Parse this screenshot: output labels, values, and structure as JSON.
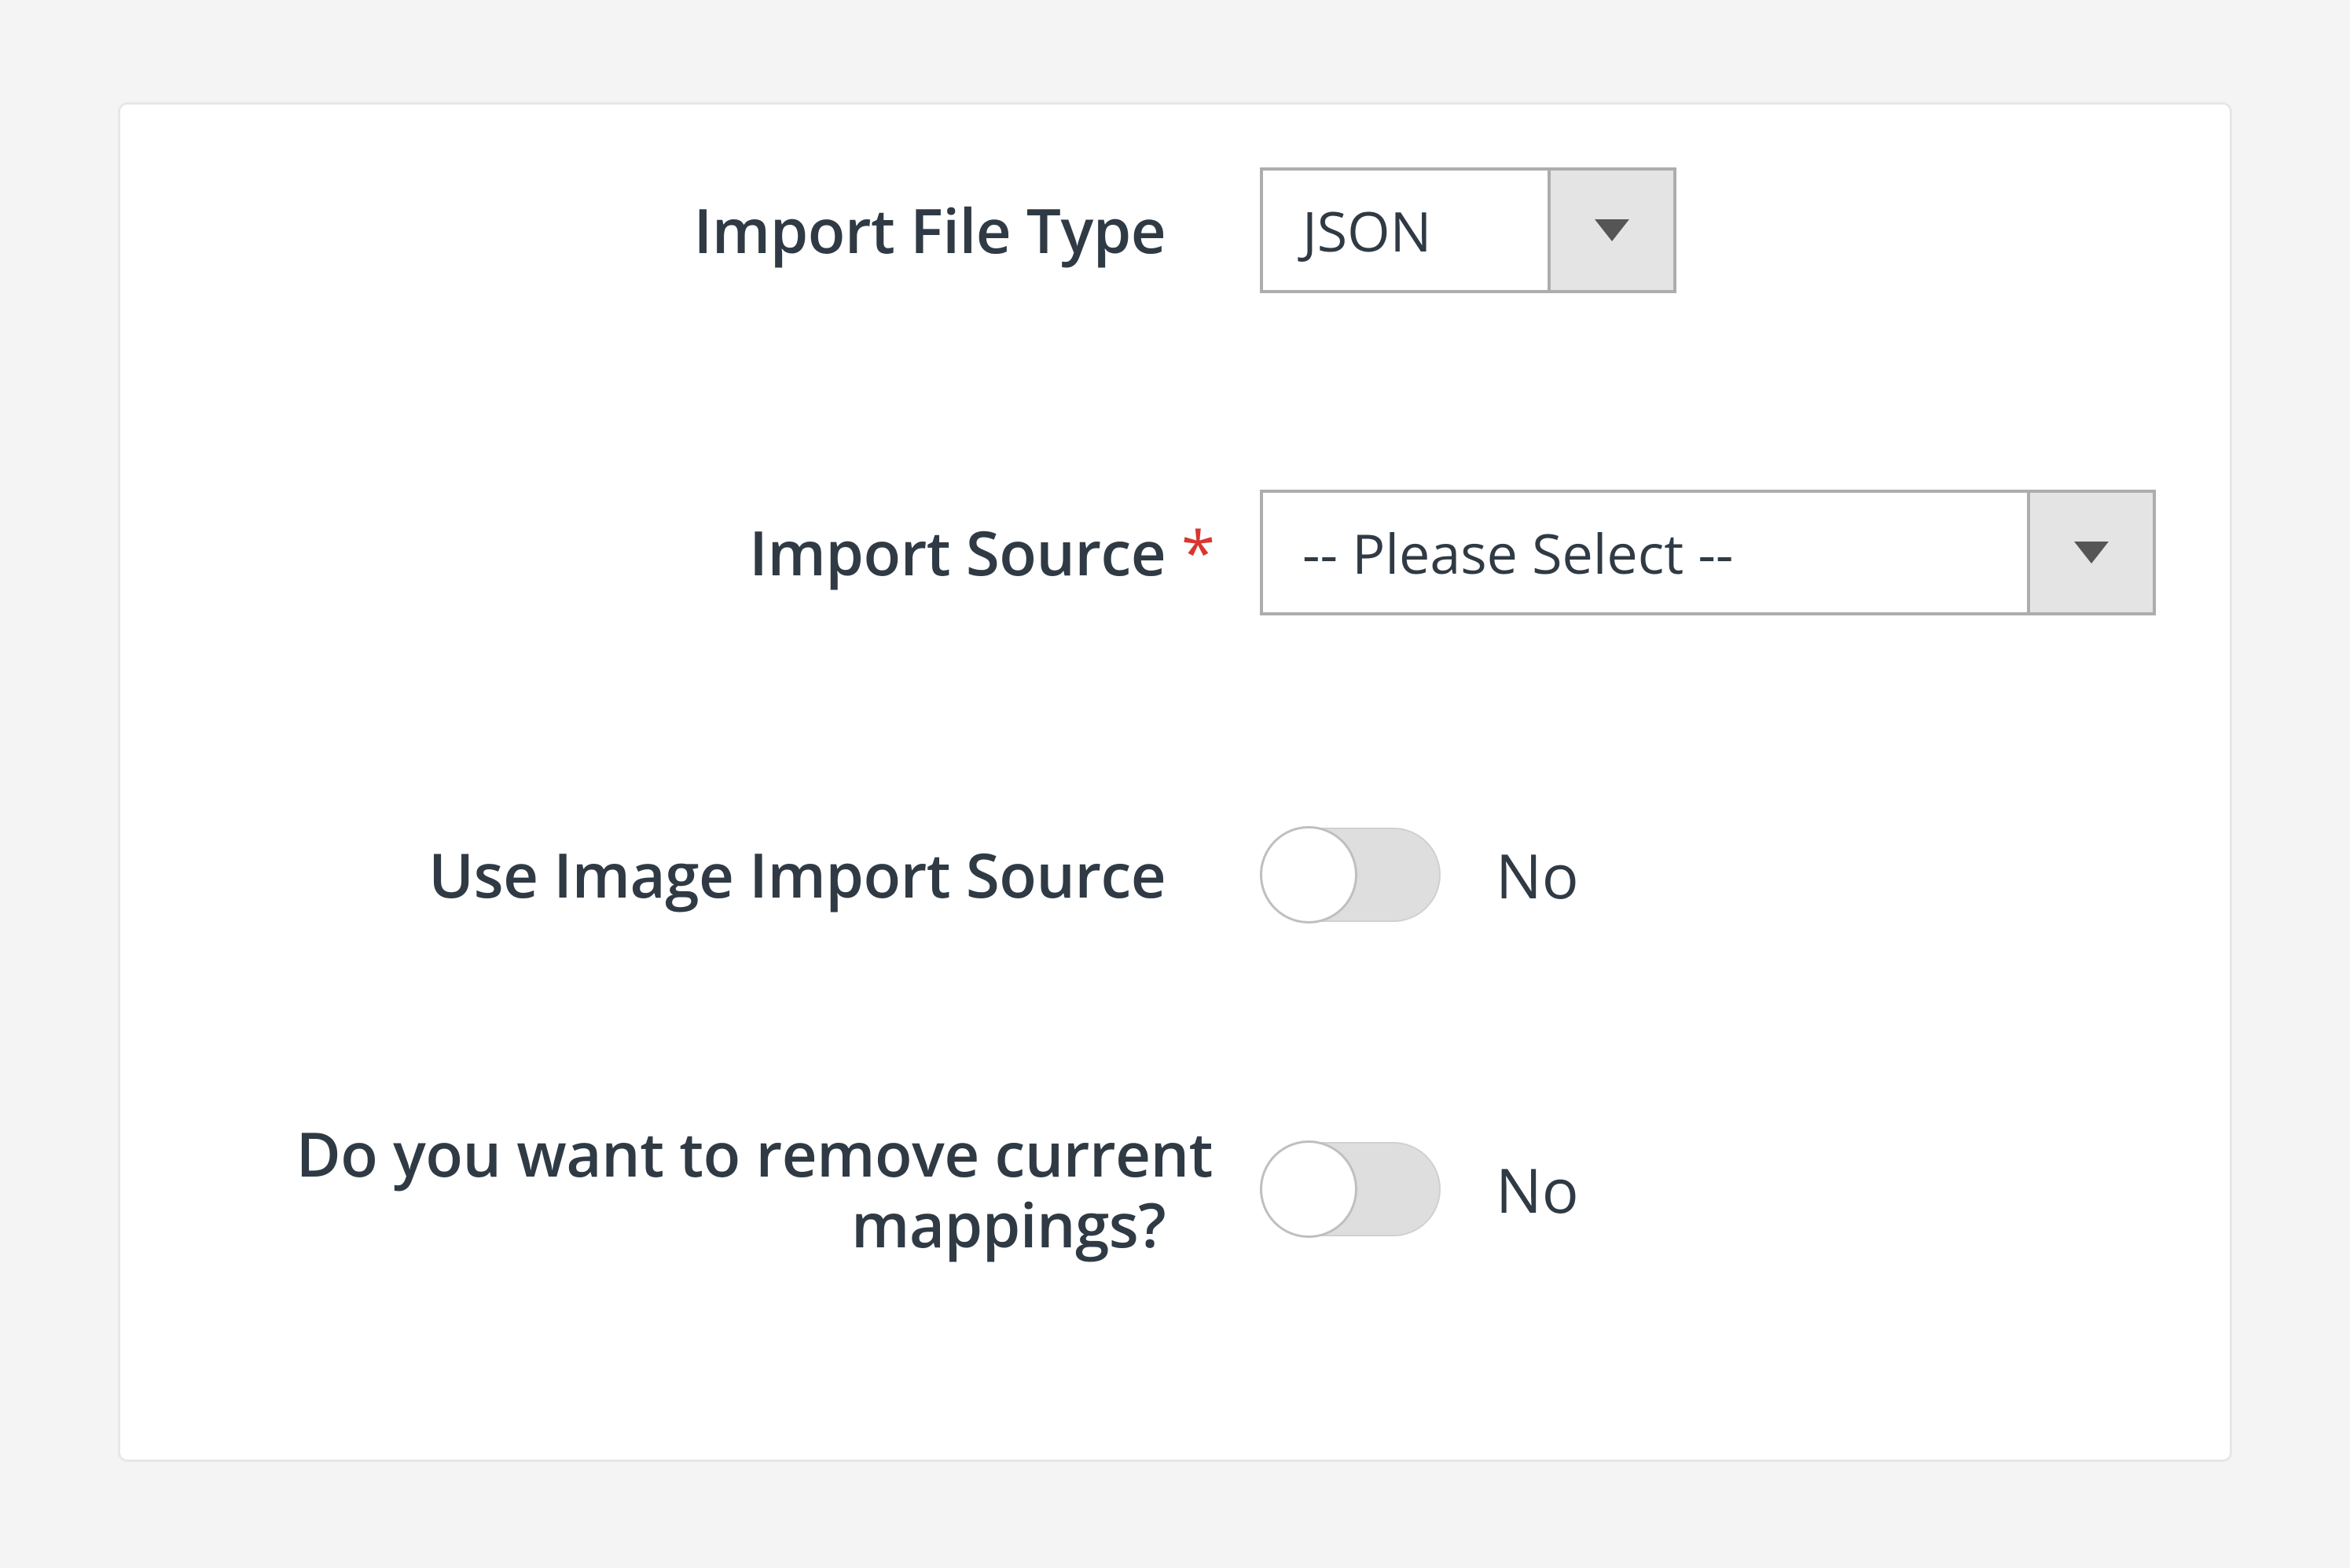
{
  "fields": {
    "fileType": {
      "label": "Import File Type",
      "value": "JSON",
      "required": false
    },
    "importSource": {
      "label": "Import Source",
      "value": "-- Please Select --",
      "required": true
    },
    "useImageImportSource": {
      "label": "Use Image Import Source",
      "value": "No"
    },
    "removeMappings": {
      "label": "Do you want to remove current mappings?",
      "value": "No"
    }
  },
  "requiredMark": "*"
}
